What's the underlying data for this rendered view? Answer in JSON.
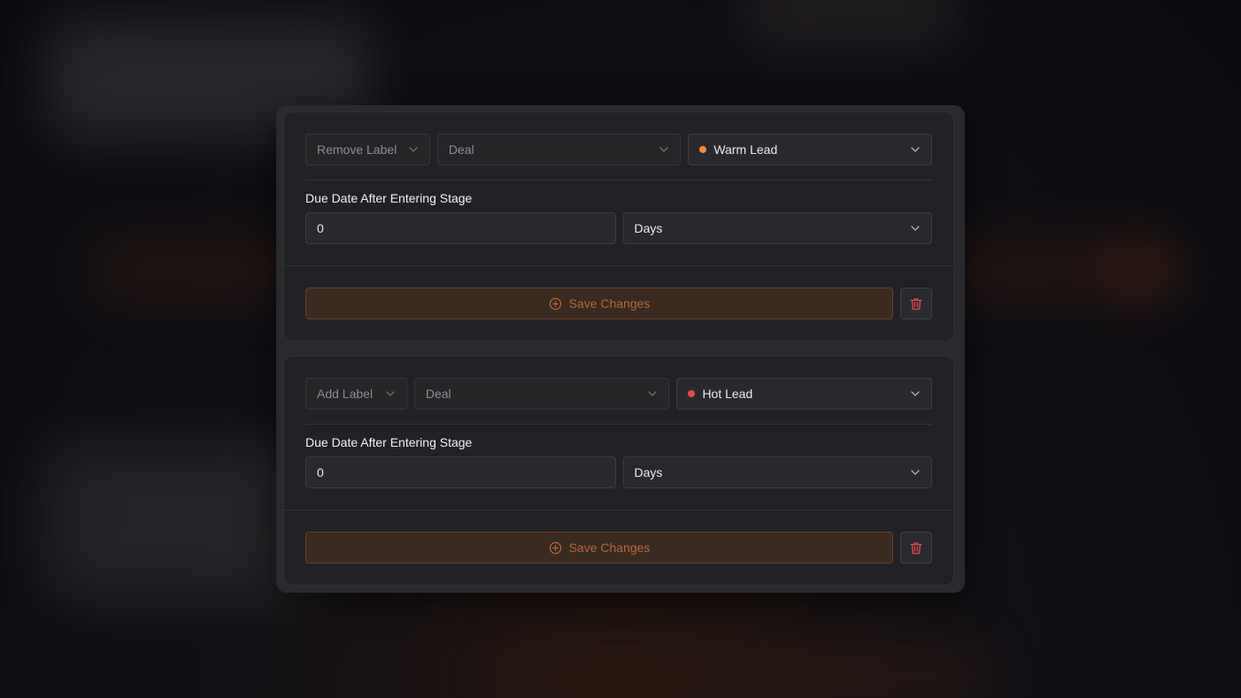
{
  "colors": {
    "accent": "#b4683a",
    "warm_lead_dot": "#f28a3c",
    "hot_lead_dot": "#e5484d",
    "danger": "#e5484d"
  },
  "cards": [
    {
      "action_select": "Remove Label",
      "entity_select": "Deal",
      "label_select": {
        "text": "Warm Lead",
        "dot_color": "#f28a3c"
      },
      "due_date": {
        "title": "Due Date After Entering Stage",
        "value": "0",
        "unit": "Days"
      },
      "save_label": "Save Changes"
    },
    {
      "action_select": "Add Label",
      "entity_select": "Deal",
      "label_select": {
        "text": "Hot Lead",
        "dot_color": "#e5484d"
      },
      "due_date": {
        "title": "Due Date After Entering Stage",
        "value": "0",
        "unit": "Days"
      },
      "save_label": "Save Changes"
    }
  ],
  "icons": {
    "chevron": "chevron-down-icon",
    "save": "plus-circle-icon",
    "delete": "trash-icon"
  }
}
